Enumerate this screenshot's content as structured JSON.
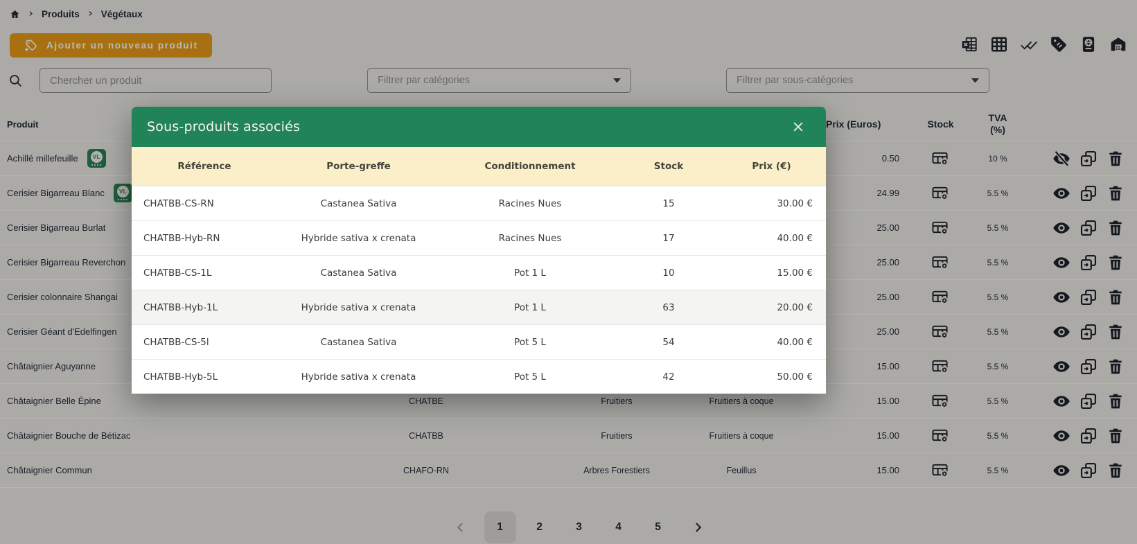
{
  "breadcrumb": {
    "items": [
      "Produits",
      "Végétaux"
    ]
  },
  "header_actions": {
    "add_product_label": "Ajouter un nouveau produit",
    "icons": [
      "excel-export-icon",
      "table-view-icon",
      "validate-all-icon",
      "labels-icon",
      "passport-icon",
      "warehouse-icon"
    ]
  },
  "filters": {
    "search_placeholder": "Chercher un produit",
    "category_placeholder": "Filtrer par catégories",
    "subcategory_placeholder": "Filtrer par sous-catégories"
  },
  "table": {
    "badge_label": "VL",
    "headers": {
      "produit": "Produit",
      "prix": "Prix (Euros)",
      "stock": "Stock",
      "tva": "TVA (%)"
    },
    "rows": [
      {
        "name": "Achillé millefeuille",
        "badge": true,
        "reference": "",
        "category": "",
        "subcategory": "",
        "price": "0.50",
        "tva": "10 %",
        "visible": false
      },
      {
        "name": "Cerisier Bigarreau Blanc",
        "badge": true,
        "reference": "",
        "category": "",
        "subcategory": "",
        "price": "24.99",
        "tva": "5.5 %",
        "visible": true
      },
      {
        "name": "Cerisier Bigarreau Burlat",
        "badge": false,
        "reference": "",
        "category": "",
        "subcategory": "",
        "price": "25.00",
        "tva": "5.5 %",
        "visible": true
      },
      {
        "name": "Cerisier Bigarreau Reverchon",
        "badge": false,
        "reference": "",
        "category": "",
        "subcategory": "",
        "price": "25.00",
        "tva": "5.5 %",
        "visible": true
      },
      {
        "name": "Cerisier colonnaire Shangai",
        "badge": false,
        "reference": "",
        "category": "",
        "subcategory": "",
        "price": "25.00",
        "tva": "5.5 %",
        "visible": true
      },
      {
        "name": "Cerisier Géant d'Edelfingen",
        "badge": false,
        "reference": "",
        "category": "",
        "subcategory": "",
        "price": "25.00",
        "tva": "5.5 %",
        "visible": true
      },
      {
        "name": "Châtaignier Aguyanne",
        "badge": false,
        "reference": "",
        "category": "",
        "subcategory": "",
        "price": "15.00",
        "tva": "5.5 %",
        "visible": true
      },
      {
        "name": "Châtaignier Belle Épine",
        "badge": false,
        "reference": "CHATBE",
        "category": "Fruitiers",
        "subcategory": "Fruitiers à coque",
        "price": "15.00",
        "tva": "5.5 %",
        "visible": true
      },
      {
        "name": "Châtaignier Bouche de Bétizac",
        "badge": false,
        "reference": "CHATBB",
        "category": "Fruitiers",
        "subcategory": "Fruitiers à coque",
        "price": "15.00",
        "tva": "5.5 %",
        "visible": true
      },
      {
        "name": "Châtaignier Commun",
        "badge": false,
        "reference": "CHAFO-RN",
        "category": "Arbres Forestiers",
        "subcategory": "Feuillus",
        "price": "15.00",
        "tva": "5.5 %",
        "visible": true
      }
    ]
  },
  "pagination": {
    "pages": [
      "1",
      "2",
      "3",
      "4",
      "5"
    ],
    "active_page": "1",
    "previous_disabled": true
  },
  "modal": {
    "title": "Sous-produits associés",
    "headers": [
      "Référence",
      "Porte-greffe",
      "Conditionnement",
      "Stock",
      "Prix (€)"
    ],
    "highlighted_row_index": 3,
    "rows": [
      {
        "reference": "CHATBB-CS-RN",
        "porte_greffe": "Castanea Sativa",
        "conditionnement": "Racines Nues",
        "stock": "15",
        "prix": "30.00 €"
      },
      {
        "reference": "CHATBB-Hyb-RN",
        "porte_greffe": "Hybride sativa x crenata",
        "conditionnement": "Racines Nues",
        "stock": "17",
        "prix": "40.00 €"
      },
      {
        "reference": "CHATBB-CS-1L",
        "porte_greffe": "Castanea Sativa",
        "conditionnement": "Pot 1 L",
        "stock": "10",
        "prix": "15.00 €"
      },
      {
        "reference": "CHATBB-Hyb-1L",
        "porte_greffe": "Hybride sativa x crenata",
        "conditionnement": "Pot 1 L",
        "stock": "63",
        "prix": "20.00 €"
      },
      {
        "reference": "CHATBB-CS-5l",
        "porte_greffe": "Castanea Sativa",
        "conditionnement": "Pot 5 L",
        "stock": "54",
        "prix": "40.00 €"
      },
      {
        "reference": "CHATBB-Hyb-5L",
        "porte_greffe": "Hybride sativa x crenata",
        "conditionnement": "Pot 5 L",
        "stock": "42",
        "prix": "50.00 €"
      }
    ]
  },
  "colors": {
    "page_background": "#EDECE8",
    "primary_button": "#E99B18",
    "modal_header_green": "#218358",
    "modal_table_header_cream": "#FAEFC8",
    "badge_green": "#2B8256",
    "text_dark": "#242B38"
  }
}
